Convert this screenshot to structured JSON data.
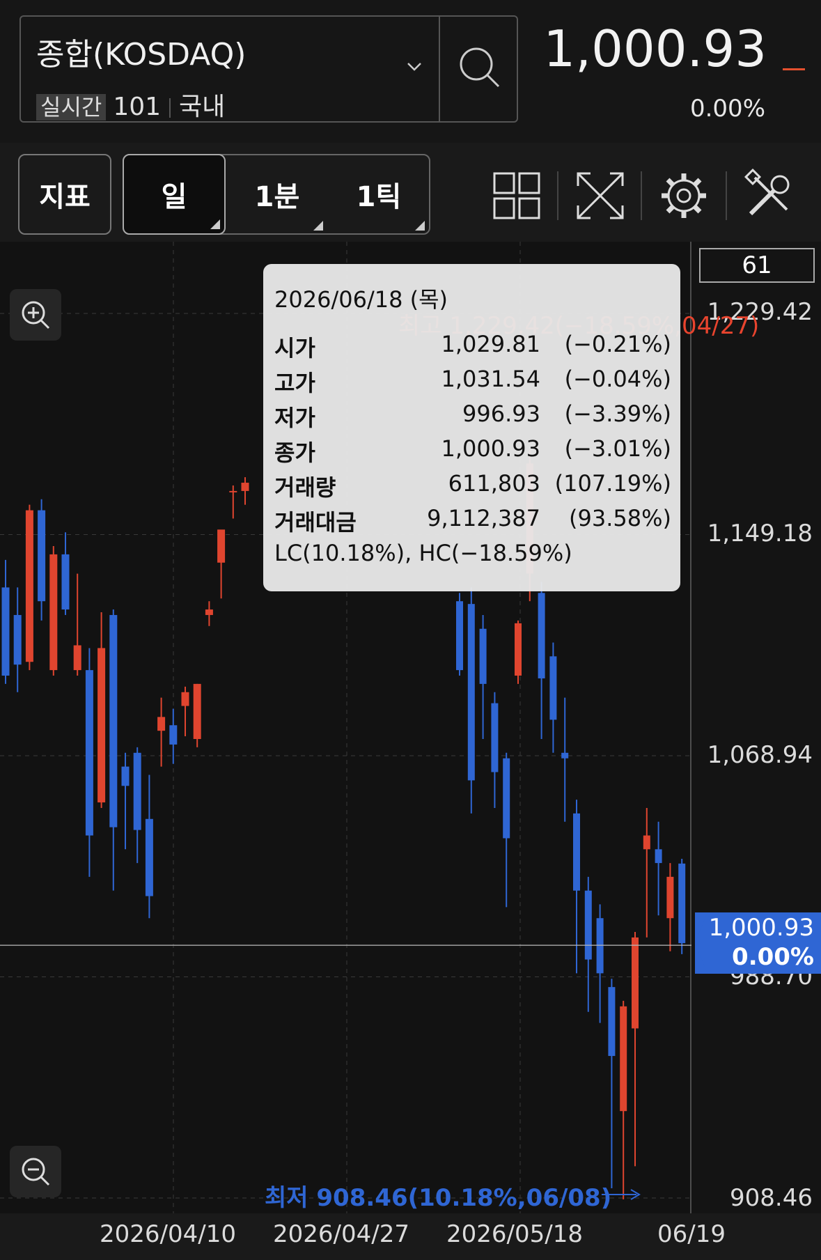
{
  "header": {
    "symbol_name": "종합(KOSDAQ)",
    "badge": "실시간",
    "code": "101",
    "market": "국내",
    "price": "1,000.93",
    "change": "0.00%"
  },
  "toolbar": {
    "indicator_label": "지표",
    "period_day": "일",
    "period_min": "1분",
    "period_tick": "1틱"
  },
  "chart": {
    "count": "61",
    "y_labels": [
      "1,229.42",
      "1,149.18",
      "1,068.94",
      "988.70",
      "908.46"
    ],
    "x_labels": [
      "2026/04/10",
      "2026/04/27",
      "2026/05/18",
      "06/19"
    ],
    "current_price": "1,000.93",
    "current_change": "0.00%",
    "high_annotation": "최고 1,229.42(−18.59%,04/27)",
    "low_annotation": "최저 908.46(10.18%,06/08)",
    "colors": {
      "up": "#e0452f",
      "down": "#2f66d4"
    },
    "tooltip": {
      "date": "2026/06/18 (목)",
      "rows": [
        {
          "label": "시가",
          "value": "1,029.81",
          "pct": "(−0.21%)"
        },
        {
          "label": "고가",
          "value": "1,031.54",
          "pct": "(−0.04%)"
        },
        {
          "label": "저가",
          "value": "996.93",
          "pct": "(−3.39%)"
        },
        {
          "label": "종가",
          "value": "1,000.93",
          "pct": "(−3.01%)"
        },
        {
          "label": "거래량",
          "value": "611,803",
          "pct": "(107.19%)"
        },
        {
          "label": "거래대금",
          "value": "9,112,387",
          "pct": "(93.58%)"
        }
      ],
      "lc_hc": "LC(10.18%), HC(−18.59%)"
    }
  },
  "chart_data": {
    "type": "candlestick",
    "y_range": [
      908.46,
      1229.42
    ],
    "candles": [
      {
        "o": 1130,
        "h": 1140,
        "l": 1095,
        "c": 1098
      },
      {
        "o": 1120,
        "h": 1130,
        "l": 1092,
        "c": 1102
      },
      {
        "o": 1103,
        "h": 1160,
        "l": 1100,
        "c": 1158
      },
      {
        "o": 1158,
        "h": 1162,
        "l": 1118,
        "c": 1125
      },
      {
        "o": 1100,
        "h": 1145,
        "l": 1098,
        "c": 1142
      },
      {
        "o": 1142,
        "h": 1150,
        "l": 1120,
        "c": 1122
      },
      {
        "o": 1100,
        "h": 1135,
        "l": 1098,
        "c": 1109
      },
      {
        "o": 1100,
        "h": 1108,
        "l": 1025,
        "c": 1040
      },
      {
        "o": 1052,
        "h": 1121,
        "l": 1050,
        "c": 1108
      },
      {
        "o": 1120,
        "h": 1122,
        "l": 1020,
        "c": 1043
      },
      {
        "o": 1065,
        "h": 1070,
        "l": 1035,
        "c": 1058
      },
      {
        "o": 1070,
        "h": 1072,
        "l": 1030,
        "c": 1042
      },
      {
        "o": 1046,
        "h": 1062,
        "l": 1010,
        "c": 1018
      },
      {
        "o": 1078,
        "h": 1090,
        "l": 1065,
        "c": 1083
      },
      {
        "o": 1080,
        "h": 1086,
        "l": 1066,
        "c": 1073
      },
      {
        "o": 1087,
        "h": 1094,
        "l": 1076,
        "c": 1092
      },
      {
        "o": 1075,
        "h": 1095,
        "l": 1072,
        "c": 1095
      },
      {
        "o": 1120,
        "h": 1125,
        "l": 1116,
        "c": 1122
      },
      {
        "o": 1139,
        "h": 1150,
        "l": 1126,
        "c": 1151
      },
      {
        "o": 1165,
        "h": 1167,
        "l": 1155,
        "c": 1165
      },
      {
        "o": 1165,
        "h": 1170,
        "l": 1160,
        "c": 1168
      }
    ],
    "candles_right": [
      {
        "o": 1125,
        "h": 1128,
        "l": 1098,
        "c": 1100
      },
      {
        "o": 1124,
        "h": 1130,
        "l": 1048,
        "c": 1060
      },
      {
        "o": 1115,
        "h": 1120,
        "l": 1075,
        "c": 1095
      },
      {
        "o": 1088,
        "h": 1092,
        "l": 1050,
        "c": 1063
      },
      {
        "o": 1068,
        "h": 1070,
        "l": 1014,
        "c": 1039
      },
      {
        "o": 1098,
        "h": 1118,
        "l": 1095,
        "c": 1117
      },
      {
        "o": 1135,
        "h": 1180,
        "l": 1125,
        "c": 1175
      },
      {
        "o": 1128,
        "h": 1132,
        "l": 1075,
        "c": 1097
      },
      {
        "o": 1105,
        "h": 1110,
        "l": 1070,
        "c": 1082
      },
      {
        "o": 1070,
        "h": 1090,
        "l": 1045,
        "c": 1068
      },
      {
        "o": 1048,
        "h": 1053,
        "l": 990,
        "c": 1020
      },
      {
        "o": 1020,
        "h": 1025,
        "l": 976,
        "c": 995
      },
      {
        "o": 1010,
        "h": 1015,
        "l": 972,
        "c": 990
      },
      {
        "o": 985,
        "h": 988,
        "l": 912,
        "c": 960
      },
      {
        "o": 940,
        "h": 980,
        "l": 908,
        "c": 978
      },
      {
        "o": 970,
        "h": 1005,
        "l": 920,
        "c": 1003
      },
      {
        "o": 1035,
        "h": 1050,
        "l": 1003,
        "c": 1040
      },
      {
        "o": 1035,
        "h": 1045,
        "l": 1011,
        "c": 1030
      },
      {
        "o": 1010,
        "h": 1030,
        "l": 998,
        "c": 1025
      },
      {
        "o": 1029.81,
        "h": 1031.54,
        "l": 996.93,
        "c": 1000.93
      }
    ]
  }
}
